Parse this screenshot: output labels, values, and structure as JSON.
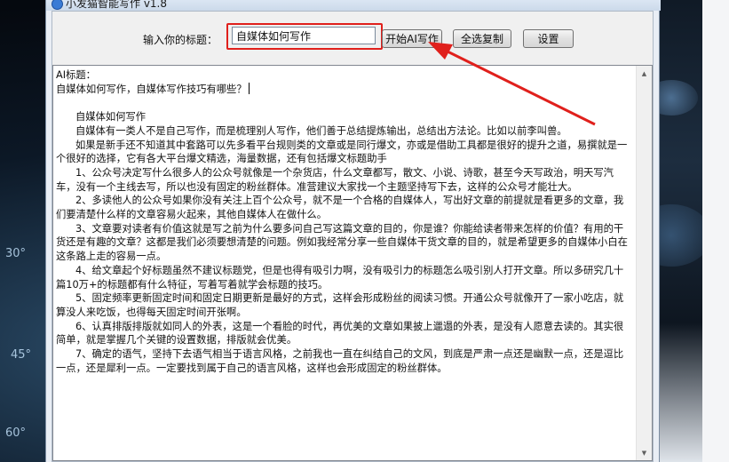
{
  "window": {
    "title": "小发猫智能写作 v1.8"
  },
  "form": {
    "prompt_label": "输入你的标题：",
    "topic_value": "自媒体如何写作"
  },
  "buttons": {
    "start": "开始AI写作",
    "select_all_copy": "全选复制",
    "settings": "设置"
  },
  "output": {
    "heading_label": "AI标题：",
    "ai_title": "自媒体如何写作，自媒体写作技巧有哪些？",
    "section_title": "自媒体如何写作",
    "paragraphs": [
      "自媒体有一类人不是自己写作，而是梳理别人写作，他们善于总结提炼输出，总结出方法论。比如以前李叫兽。",
      "如果是新手还不知道其中套路可以先多看平台规则类的文章或是同行爆文，亦或是借助工具都是很好的提升之道，易撰就是一个很好的选择，它有各大平台爆文精选，海量数据，还有包括爆文标题助手",
      "1、公众号决定写什么很多人的公众号就像是一个杂货店，什么文章都写，散文、小说、诗歌，甚至今天写政治，明天写汽车，没有一个主线去写，所以也没有固定的粉丝群体。准营建议大家找一个主题坚持写下去，这样的公众号才能壮大。",
      "2、多读他人的公众号如果你没有关注上百个公众号，就不是一个合格的自媒体人，写出好文章的前提就是看更多的文章，我们要清楚什么样的文章容易火起来，其他自媒体人在做什么。",
      "3、文章要对读者有价值这就是写之前为什么要多问自己写这篇文章的目的，你是谁？你能给读者带来怎样的价值？有用的干货还是有趣的文章？这都是我们必须要想清楚的问题。例如我经常分享一些自媒体干货文章的目的，就是希望更多的自媒体小白在这条路上走的容易一点。",
      "4、给文章起个好标题虽然不建议标题党，但是也得有吸引力啊，没有吸引力的标题怎么吸引别人打开文章。所以多研究几十篇10万+的标题都有什么特征，写着写着就学会标题的技巧。",
      "5、固定频率更新固定时间和固定日期更新是最好的方式，这样会形成粉丝的阅读习惯。开通公众号就像开了一家小吃店，就算没人来吃饭，也得每天固定时间开张啊。",
      "6、认真排版排版就如同人的外表，这是一个看脸的时代，再优美的文章如果披上邋遢的外表，是没有人愿意去读的。其实很简单，就是掌握几个关键的设置数据，排版就会优美。",
      "7、确定的语气，坚持下去语气相当于语言风格，之前我也一直在纠结自己的文风，到底是严肃一点还是幽默一点，还是逗比一点，还是犀利一点。一定要找到属于自己的语言风格，这样也会形成固定的粉丝群体。"
    ]
  },
  "wallpaper": {
    "dial_labels": [
      "30°",
      "45°",
      "60°"
    ]
  },
  "colors": {
    "highlight": "#e0201c",
    "window_border": "#7d8ea3"
  }
}
